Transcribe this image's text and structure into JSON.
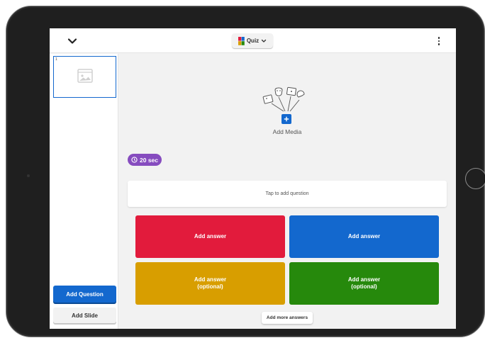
{
  "topbar": {
    "quiz_type_label": "Quiz"
  },
  "sidebar": {
    "slides": [
      {
        "number": "1"
      }
    ],
    "add_question_label": "Add Question",
    "add_slide_label": "Add Slide"
  },
  "editor": {
    "add_media_label": "Add Media",
    "time_limit": "20 sec",
    "question_placeholder": "Tap to add question",
    "answers": [
      {
        "label": "Add answer",
        "color": "#e21b3c"
      },
      {
        "label": "Add answer",
        "color": "#1368ce"
      },
      {
        "label": "Add answer\n(optional)",
        "color": "#d89e00"
      },
      {
        "label": "Add answer\n(optional)",
        "color": "#26890c"
      }
    ],
    "add_more_answers_label": "Add more answers"
  },
  "colors": {
    "accent": "#1368ce",
    "timer": "#864cbf"
  }
}
